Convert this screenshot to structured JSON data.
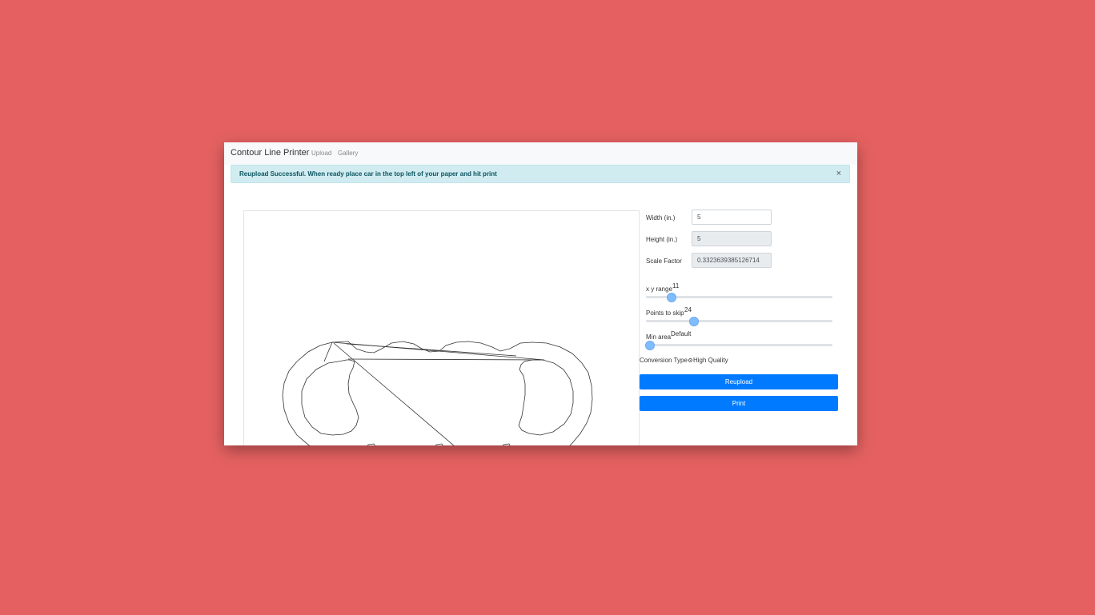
{
  "navbar": {
    "brand": "Contour Line Printer",
    "links": [
      "Upload",
      "Gallery"
    ]
  },
  "alert": {
    "message": "Reupload Successful. When ready place car in the top left of your paper and hit print",
    "close": "×"
  },
  "form": {
    "width": {
      "label": "Width (in.)",
      "value": "5"
    },
    "height": {
      "label": "Height (in.)",
      "value": "5"
    },
    "scale": {
      "label": "Scale Factor",
      "value": "0.3323639385126714"
    }
  },
  "sliders": {
    "xy_range": {
      "label": "x y range",
      "value": "11"
    },
    "points_to_skip": {
      "label": "Points to skip",
      "value": "24"
    },
    "min_area": {
      "label": "Min area",
      "value": "Default"
    }
  },
  "conversion": {
    "label": "Conversion Type",
    "option": "High Quality"
  },
  "buttons": {
    "reupload": "Reupload",
    "print": "Print"
  },
  "colors": {
    "background": "#e56161",
    "primary": "#007bff",
    "alert_bg": "#d1ecf1",
    "alert_text": "#0c5460"
  }
}
